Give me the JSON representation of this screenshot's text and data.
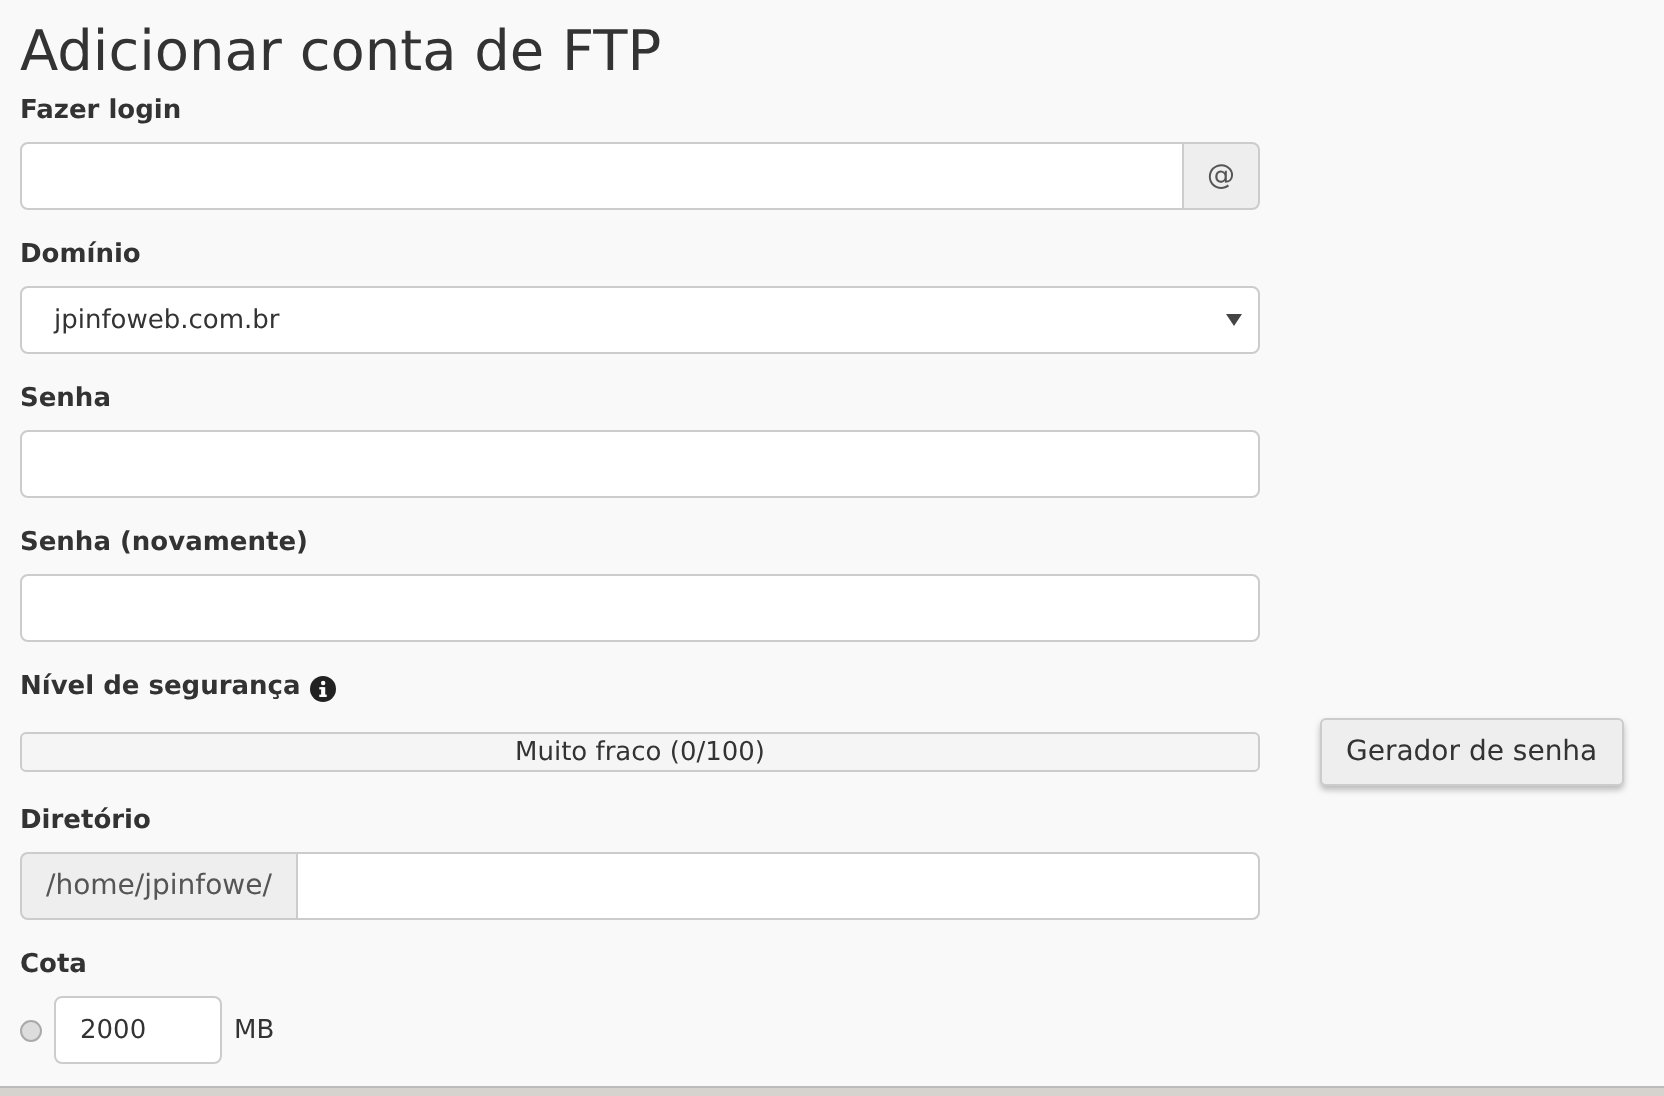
{
  "title": "Adicionar conta de FTP",
  "login": {
    "label": "Fazer login",
    "addon": "@"
  },
  "domain": {
    "label": "Domínio",
    "value": "jpinfoweb.com.br"
  },
  "password": {
    "label": "Senha"
  },
  "password_again": {
    "label": "Senha (novamente)"
  },
  "strength": {
    "label": "Nível de segurança",
    "reading": "Muito fraco (0/100)",
    "level": 0,
    "button": "Gerador de senha"
  },
  "directory": {
    "label": "Diretório",
    "prefix": "/home/jpinfowe/"
  },
  "quota": {
    "label": "Cota",
    "selected": false,
    "value": "2000",
    "unit": "MB"
  }
}
